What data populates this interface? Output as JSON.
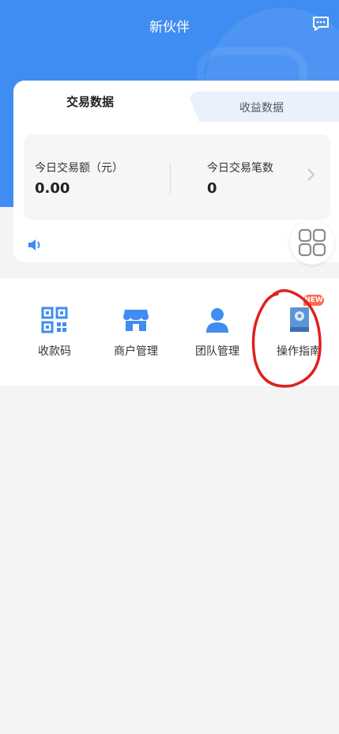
{
  "header": {
    "title": "新伙伴"
  },
  "tabs": {
    "active": "交易数据",
    "inactive": "收益数据"
  },
  "stats": {
    "amount_label": "今日交易额（元）",
    "amount_value": "0.00",
    "count_label": "今日交易笔数",
    "count_value": "0"
  },
  "menu": [
    {
      "label": "收款码",
      "icon": "qr-code-icon"
    },
    {
      "label": "商户管理",
      "icon": "store-icon"
    },
    {
      "label": "团队管理",
      "icon": "user-icon"
    },
    {
      "label": "操作指南",
      "icon": "book-gear-icon"
    }
  ],
  "badge": {
    "new": "NEW"
  },
  "colors": {
    "primary": "#3f8cf2",
    "badge": "#ff6a4b",
    "annotation": "#e02020"
  }
}
